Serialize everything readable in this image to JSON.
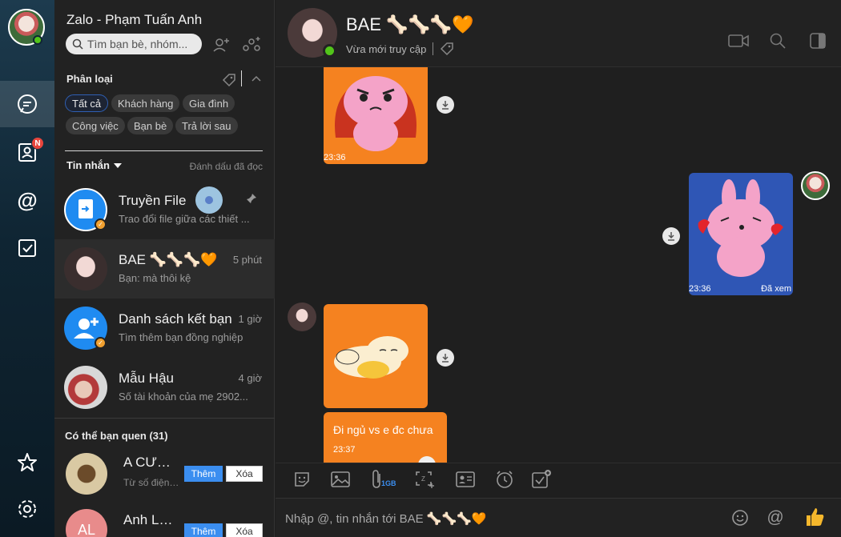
{
  "app": {
    "title": "Zalo - Phạm Tuấn Anh"
  },
  "search": {
    "placeholder": "Tìm bạn bè, nhóm..."
  },
  "filters": {
    "label": "Phân loại",
    "chips": [
      "Tất cả",
      "Khách hàng",
      "Gia đình",
      "Công việc",
      "Bạn bè",
      "Trả lời sau"
    ],
    "active": "Tất cả"
  },
  "messages_tab": {
    "label": "Tin nhắn",
    "mark_read": "Đánh dấu đã đọc"
  },
  "rail": {
    "contacts_badge": "N"
  },
  "conversations": [
    {
      "name": "Truyền File",
      "preview": "Trao đổi file giữa các thiết ...",
      "time": ""
    },
    {
      "name": "BAE 🦴🦴🦴🧡",
      "preview": "Bạn: mà thôi kệ",
      "time": "5 phút"
    },
    {
      "name": "Danh sách kết bạn",
      "preview": "Tìm thêm bạn đồng nghiệp",
      "time": "1 giờ"
    },
    {
      "name": "Mẫu Hậu",
      "preview": "Số tài khoản của mẹ 2902...",
      "time": "4 giờ"
    }
  ],
  "suggestions": {
    "title": "Có thể bạn quen (31)",
    "items": [
      {
        "name": "A CƯỜNG",
        "sub": "Từ số điện ...",
        "add": "Thêm",
        "remove": "Xóa"
      },
      {
        "name": "Anh Long",
        "sub": "",
        "add": "Thêm",
        "remove": "Xóa",
        "initials": "AL"
      }
    ]
  },
  "chat": {
    "name": "BAE 🦴🦴🦴🧡",
    "status": "Vừa mới truy cập",
    "messages": [
      {
        "kind": "sticker",
        "time": "23:36",
        "from": "them"
      },
      {
        "kind": "sticker",
        "time": "23:36",
        "from": "me",
        "seen": "Đã xem"
      },
      {
        "kind": "sticker",
        "time": "",
        "from": "them"
      },
      {
        "kind": "text",
        "text": "Đi ngủ vs e đc chưa",
        "time": "23:37",
        "from": "them"
      }
    ]
  },
  "toolbar": {
    "file_size_label": "1GB"
  },
  "composer": {
    "placeholder": "Nhập @, tin nhắn tới BAE 🦴🦴🦴🧡"
  },
  "colors": {
    "accent_orange": "#f58220",
    "online_green": "#52c41a",
    "add_blue": "#3b8ef0",
    "sticker_blue": "#2f56b5"
  }
}
